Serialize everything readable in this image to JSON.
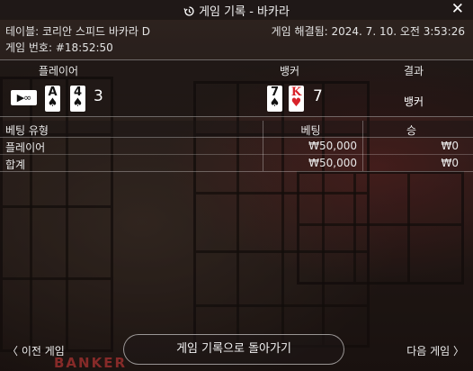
{
  "header": {
    "title": "게임 기록 - 바카라",
    "close_glyph": "✕",
    "table_name": "테이블: 코리안 스피드 바카라 D",
    "resolved": "게임 해결됨: 2024. 7. 10. 오전 3:53:26",
    "game_number": "게임 번호: #18:52:50"
  },
  "results": {
    "player_label": "플레이어",
    "banker_label": "뱅커",
    "result_label": "결과",
    "player_side_card": "▶∞",
    "player_cards": [
      {
        "rank": "A",
        "suit": "♠",
        "color": "#111111"
      },
      {
        "rank": "4",
        "suit": "♠",
        "color": "#111111"
      }
    ],
    "player_score": "3",
    "banker_cards": [
      {
        "rank": "7",
        "suit": "♠",
        "color": "#111111"
      },
      {
        "rank": "K",
        "suit": "♥",
        "color": "#d8232a"
      }
    ],
    "banker_score": "7",
    "winner": "뱅커"
  },
  "bets": {
    "columns": [
      "베팅 유형",
      "베팅",
      "승"
    ],
    "rows": [
      {
        "type": "플레이어",
        "bet": "₩50,000",
        "win": "₩0"
      },
      {
        "type": "합계",
        "bet": "₩50,000",
        "win": "₩0"
      }
    ]
  },
  "footer": {
    "prev_label": "〈  이전 게임",
    "back_label": "게임 기록으로 돌아가기",
    "next_label": "다음 게임  〉"
  },
  "background": {
    "table_text": "BANKER"
  }
}
